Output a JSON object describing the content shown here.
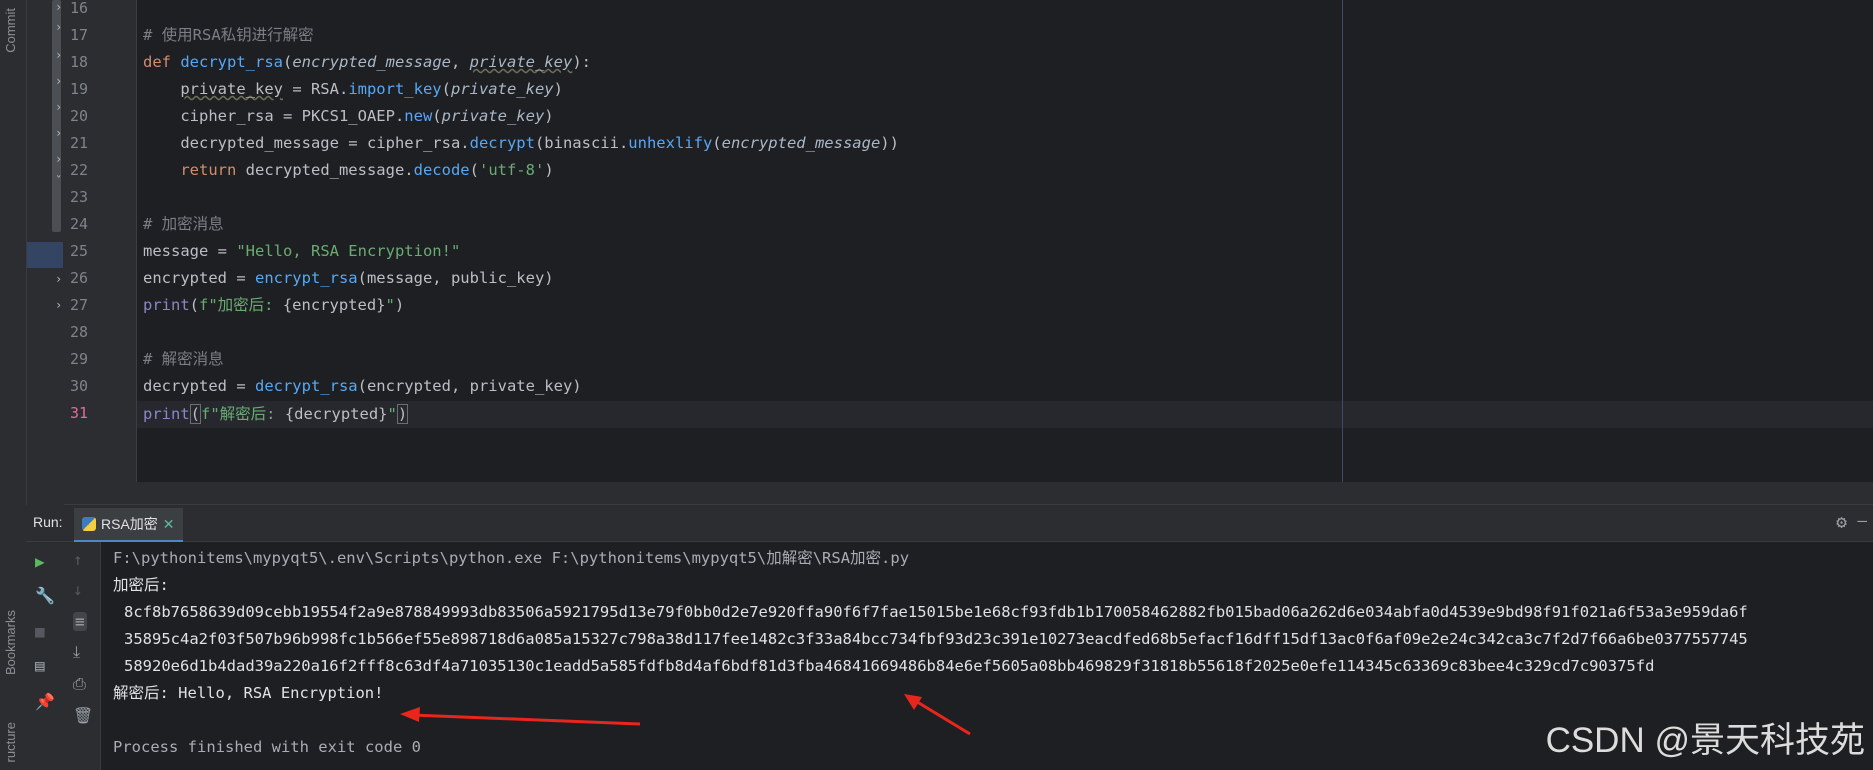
{
  "side_labels": {
    "commit": "Commit",
    "bookmarks": "Bookmarks",
    "structure": "ructure"
  },
  "editor": {
    "line_numbers": [
      "16",
      "17",
      "18",
      "19",
      "20",
      "21",
      "22",
      "23",
      "24",
      "25",
      "26",
      "27",
      "28",
      "29",
      "30",
      "31"
    ],
    "current_line": "31",
    "lines": {
      "l17": {
        "comment": "# 使用RSA私钥进行解密"
      },
      "l18": {
        "kw": "def",
        "fname": "decrypt_rsa",
        "p1": "encrypted_message",
        "p2": "private_key"
      },
      "l19": {
        "a": "private_key",
        "b": " = RSA.",
        "c": "import_key",
        "d": "private_key"
      },
      "l20": {
        "a": "cipher_rsa = PKCS1_OAEP.",
        "b": "new",
        "c": "private_key"
      },
      "l21": {
        "a": "decrypted_message = cipher_rsa.",
        "b": "decrypt",
        "c": "binascii.",
        "d": "unhexlify",
        "e": "encrypted_message"
      },
      "l22": {
        "kw": "return",
        "a": " decrypted_message.",
        "b": "decode",
        "c": "'utf-8'"
      },
      "l24": {
        "comment": "# 加密消息"
      },
      "l25": {
        "a": "message = ",
        "b": "\"Hello, RSA Encryption!\""
      },
      "l26": {
        "a": "encrypted = ",
        "b": "encrypt_rsa",
        "c": "(message, public_key)"
      },
      "l27": {
        "a": "print",
        "b": "f\"加密后: ",
        "c": "{encrypted}",
        "d": "\""
      },
      "l29": {
        "comment": "# 解密消息"
      },
      "l30": {
        "a": "decrypted = ",
        "b": "decrypt_rsa",
        "c": "(encrypted, private_key)"
      },
      "l31": {
        "a": "print",
        "b": "f\"解密后: ",
        "c": "{decrypted}",
        "d": "\""
      }
    }
  },
  "run": {
    "label": "Run:",
    "tab": "RSA加密",
    "console": {
      "command": "F:\\pythonitems\\mypyqt5\\.env\\Scripts\\python.exe F:\\pythonitems\\mypyqt5\\加解密\\RSA加密.py",
      "enc_label": "加密后:",
      "hex1": "8cf8b7658639d09cebb19554f2a9e878849993db83506a5921795d13e79f0bb0d2e7e920ffa90f6f7fae15015be1e68cf93fdb1b170058462882fb015bad06a262d6e034abfa0d4539e9bd98f91f021a6f53a3e959da6f",
      "hex2": "35895c4a2f03f507b96b998fc1b566ef55e898718d6a085a15327c798a38d117fee1482c3f33a84bcc734fbf93d23c391e10273eacdfed68b5efacf16dff15df13ac0f6af09e2e24c342ca3c7f2d7f66a6be0377557745",
      "hex3": "58920e6d1b4dad39a220a16f2fff8c63df4a71035130c1eadd5a585fdfb8d4af6bdf81d3fba46841669486b84e6ef5605a08bb469829f31818b55618f2025e0efe114345c63369c83bee4c329cd7c90375fd",
      "dec_line": "解密后: Hello, RSA Encryption!",
      "finished": "Process finished with exit code 0"
    }
  },
  "watermark": "CSDN @景天科技苑",
  "colors": {
    "arrow": "#e8261c"
  }
}
